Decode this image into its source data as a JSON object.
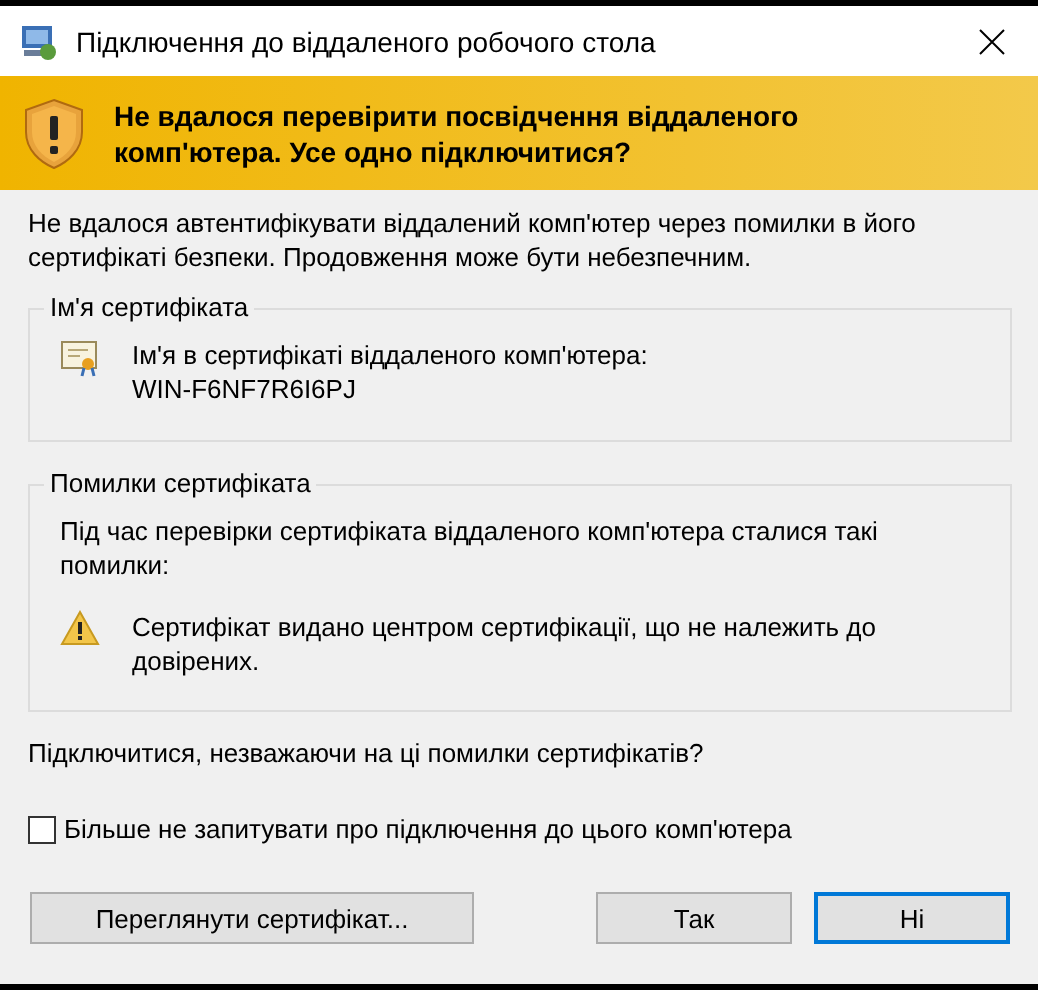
{
  "window": {
    "title": "Підключення до віддаленого робочого стола"
  },
  "banner": {
    "text": "Не вдалося перевірити посвідчення віддаленого комп'ютера. Усе одно підключитися?"
  },
  "intro": "Не вдалося автентифікувати віддалений комп'ютер через помилки в його сертифікаті безпеки. Продовження може бути небезпечним.",
  "certificate_name": {
    "title": "Ім'я сертифіката",
    "label": "Ім'я в сертифікаті віддаленого комп'ютера:",
    "value": "WIN-F6NF7R6I6PJ"
  },
  "certificate_errors": {
    "title": "Помилки сертифіката",
    "intro": "Під час перевірки сертифіката віддаленого комп'ютера сталися такі помилки:",
    "errors": [
      "Сертифікат видано центром сертифікації, що не належить до довірених."
    ]
  },
  "question": "Підключитися, незважаючи на ці помилки сертифікатів?",
  "dont_ask": {
    "label": "Більше не запитувати про підключення до цього комп'ютера",
    "checked": false
  },
  "buttons": [
    {
      "label": "Переглянути сертифікат...",
      "kind": "wide",
      "default": false
    },
    {
      "label": "Так",
      "kind": "normal",
      "default": false
    },
    {
      "label": "Ні",
      "kind": "normal",
      "default": true
    }
  ]
}
